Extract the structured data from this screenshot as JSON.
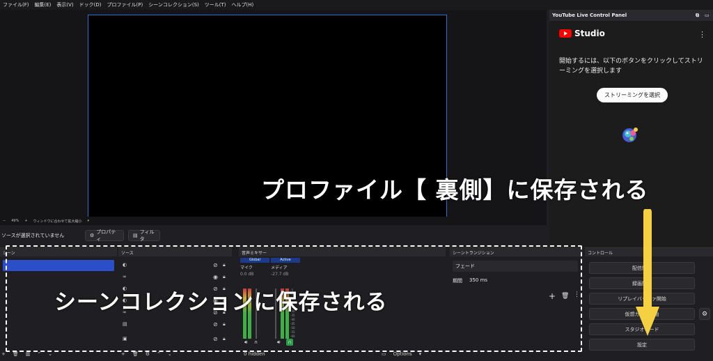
{
  "menu": [
    "ファイル(F)",
    "編集(E)",
    "表示(V)",
    "ドック(D)",
    "プロファイル(P)",
    "シーンコレクション(S)",
    "ツール(T)",
    "ヘルプ(H)"
  ],
  "zoom": {
    "minus": "−",
    "value": "49%",
    "plus": "+",
    "fit": "ウィンドウに合わせて拡大縮小"
  },
  "source_bar": {
    "status": "ソースが選択されていません",
    "properties": "プロパティ",
    "filters": "フィルタ"
  },
  "yt": {
    "panel_title": "YouTube Live Control Panel",
    "logo": "Studio",
    "more": "⋮",
    "description": "開始するには、以下のボタンをクリックしてストリーミングを選択します",
    "stream_button": "ストリーミングを選択"
  },
  "docks": {
    "scenes_title": "シーン",
    "sources_title": "ソース",
    "mixer_title": "音声ミキサー",
    "transitions_title": "シーントランジション",
    "controls_title": "コントロール"
  },
  "mixer": {
    "col1": {
      "header": "Global",
      "name": "マイク",
      "db": "0.0 dB"
    },
    "col2": {
      "header": "Active",
      "name": "メディア",
      "db": "-27.7 dB"
    },
    "hidden": "0 hidden",
    "options": "Options",
    "scale": [
      "-5",
      "-10",
      "-15",
      "-20",
      "-25",
      "-30",
      "-35",
      "-40",
      "-45",
      "-50",
      "-55",
      "-60"
    ]
  },
  "transitions": {
    "selected": "フェード",
    "duration_label": "期間",
    "duration_value": "350 ms"
  },
  "controls": {
    "start_streaming": "配信開始",
    "start_recording": "録画開始",
    "replay_buffer": "リプレイバッファ開始",
    "virtual_camera": "仮想カメラ開始",
    "studio_mode": "スタジオモード",
    "settings": "設定"
  },
  "overlay": {
    "profile_text": "プロファイル【 裏側】に保存される",
    "scene_text": "シーンコレクションに保存される"
  },
  "colors": {
    "accent": "#2c4fc9",
    "yt_red": "#ff0000",
    "arrow": "#f5d142",
    "preview_border": "#2f6fd8"
  }
}
